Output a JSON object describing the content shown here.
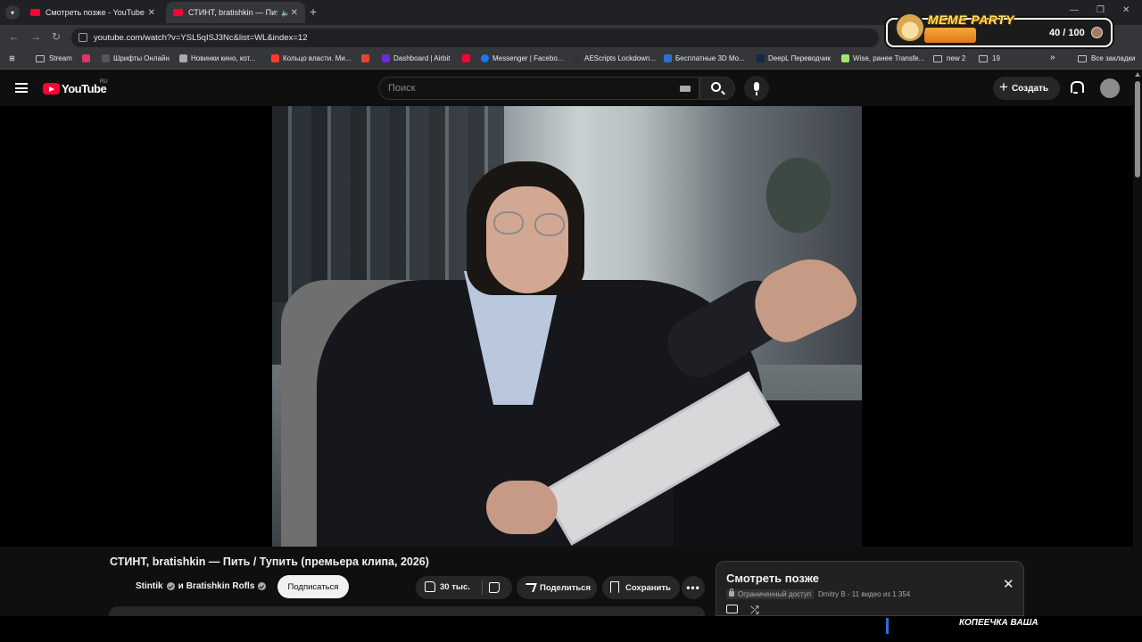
{
  "browser": {
    "tabs": [
      {
        "title": "Смотреть позже - YouTube",
        "active": false
      },
      {
        "title": "СТИНТ, bratishkin — Пить /",
        "active": true
      }
    ],
    "new_tab_symbol": "+",
    "window_controls": [
      "—",
      "❐",
      "✕"
    ],
    "url": "youtube.com/watch?v=YSL5qISJ3Nc&list=WL&index=12",
    "bookmarks": [
      {
        "label": "Stream",
        "icon": "folder-icon",
        "color": "#bdc1c6"
      },
      {
        "label": "",
        "icon": "lm-icon",
        "color": "#e2336b"
      },
      {
        "label": "Шрифты Онлайн",
        "icon": "font-icon",
        "color": "#555"
      },
      {
        "label": "Новинки кино, кот...",
        "icon": "film-icon",
        "color": "#aaa"
      },
      {
        "label": "Кольцо власти. Ми...",
        "icon": "kinopoisk-icon",
        "color": "#ff3b30"
      },
      {
        "label": "",
        "icon": "gmail-icon",
        "color": "#ea4335"
      },
      {
        "label": "Dashboard | Airbit",
        "icon": "airbit-icon",
        "color": "#6a2bd8"
      },
      {
        "label": "",
        "icon": "youtube-icon",
        "color": "#ff0033"
      },
      {
        "label": "Messenger | Facebo...",
        "icon": "facebook-icon",
        "color": "#1877f2"
      },
      {
        "label": "AEScripts Lockdown...",
        "icon": "aescripts-icon",
        "color": "#333"
      },
      {
        "label": "Бесплатные 3D Мо...",
        "icon": "3d-icon",
        "color": "#2f6fd1"
      },
      {
        "label": "DeepL Переводчик",
        "icon": "deepl-icon",
        "color": "#0f2b46"
      },
      {
        "label": "Wise, ранее Transfe...",
        "icon": "wise-icon",
        "color": "#9fe870"
      },
      {
        "label": "new 2",
        "icon": "folder-icon",
        "color": "#bdc1c6"
      },
      {
        "label": "19",
        "icon": "folder-icon",
        "color": "#bdc1c6"
      }
    ],
    "more_bookmarks": "»",
    "all_bookmarks": "Все закладки"
  },
  "meme_party": {
    "title": "MEME PARTY",
    "progress": "40 / 100",
    "progress_value": 40,
    "progress_max": 100,
    "accent": "#f8a838"
  },
  "youtube": {
    "logo_text": "YouTube",
    "region": "RU",
    "search_placeholder": "Поиск",
    "create_label": "Создать",
    "brand_color": "#ff0033"
  },
  "video": {
    "title": "СТИНТ, bratishkin — Пить / Тупить (премьера клипа, 2026)",
    "channel_1": "Stintik",
    "channel_joiner": "и",
    "channel_2": "Bratishkin Rofls",
    "subscribe_label": "Подписаться",
    "likes": "30 тыс.",
    "share_label": "Поделиться",
    "save_label": "Сохранить",
    "more_label": "•••"
  },
  "playlist": {
    "title": "Смотреть позже",
    "privacy": "Ограниченный доступ",
    "meta": "Dmitry B - 11 видео из 1 354",
    "close_symbol": "✕",
    "shuffle_symbol": "⤮"
  },
  "overlay": {
    "text": "КОПЕЕЧКА ВАША"
  }
}
